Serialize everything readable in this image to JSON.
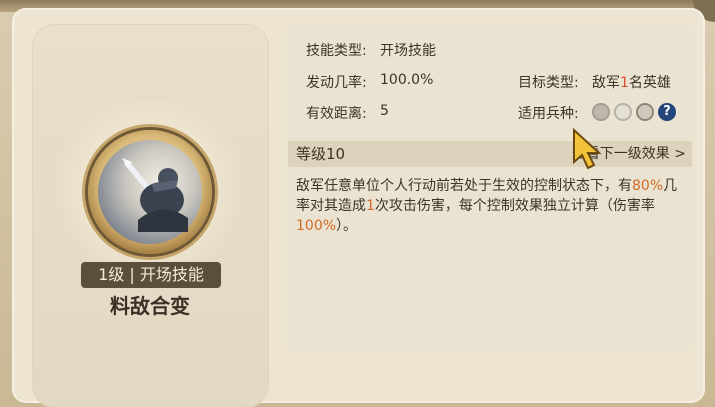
{
  "skill": {
    "level_tag": "1级 | 开场技能",
    "name": "料敌合变"
  },
  "info": {
    "type_label": "技能类型:",
    "type_value": "开场技能",
    "rate_label": "发动几率:",
    "rate_value": "100.0%",
    "range_label": "有效距离:",
    "range_value": "5",
    "target_label": "目标类型:",
    "target_prefix": "敌军",
    "target_count": "1",
    "target_suffix": "名英雄",
    "troops_label": "适用兵种:"
  },
  "level": {
    "label": "等级10",
    "next_text": "查看下一级效果 >"
  },
  "description": {
    "part1": "敌军任意单位个人行动前若处于生效的控制状态下，有",
    "pct1": "80%",
    "part2": "几率对其造成",
    "count": "1",
    "part3": "次攻击伤害，每个控制效果独立计算（伤害率",
    "pct2": "100%",
    "part4": "）。"
  },
  "icons": [
    "cavalry-icon",
    "shield-icon",
    "archer-icon",
    "help-icon"
  ],
  "colors": {
    "highlight": "#d26a2a",
    "level_tag_bg": "#5b4e3c",
    "help_blue": "#23467a"
  }
}
